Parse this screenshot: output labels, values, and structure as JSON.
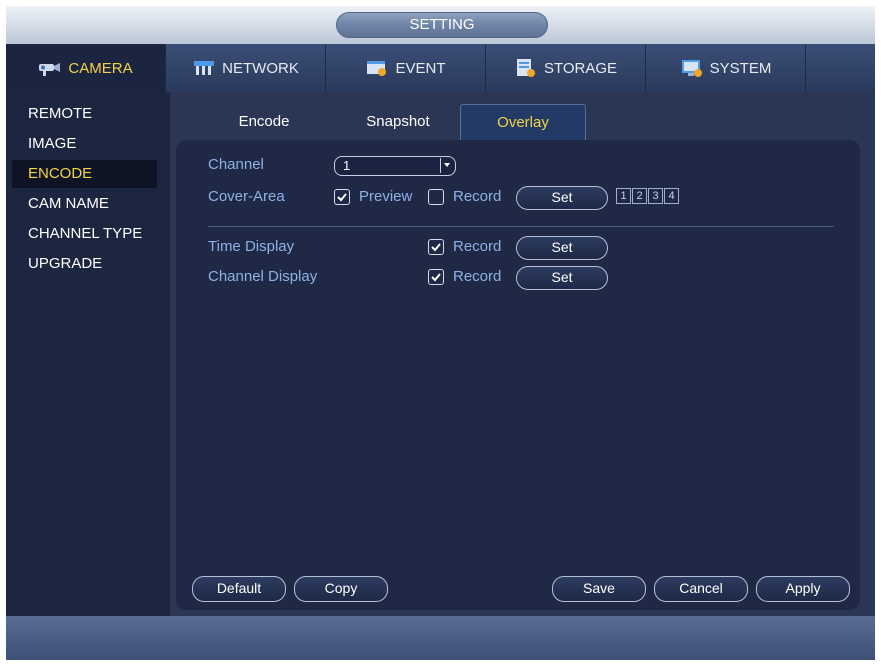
{
  "window": {
    "title": "SETTING"
  },
  "main_tabs": [
    {
      "label": "CAMERA",
      "icon": "camera-icon",
      "active": true
    },
    {
      "label": "NETWORK",
      "icon": "network-icon",
      "active": false
    },
    {
      "label": "EVENT",
      "icon": "event-icon",
      "active": false
    },
    {
      "label": "STORAGE",
      "icon": "storage-icon",
      "active": false
    },
    {
      "label": "SYSTEM",
      "icon": "system-icon",
      "active": false
    }
  ],
  "sidebar": {
    "items": [
      {
        "label": "REMOTE",
        "active": false
      },
      {
        "label": "IMAGE",
        "active": false
      },
      {
        "label": "ENCODE",
        "active": true
      },
      {
        "label": "CAM NAME",
        "active": false
      },
      {
        "label": "CHANNEL TYPE",
        "active": false
      },
      {
        "label": "UPGRADE",
        "active": false
      }
    ]
  },
  "sub_tabs": [
    {
      "label": "Encode",
      "active": false
    },
    {
      "label": "Snapshot",
      "active": false
    },
    {
      "label": "Overlay",
      "active": true
    }
  ],
  "overlay": {
    "channel": {
      "label": "Channel",
      "value": "1"
    },
    "cover_area": {
      "label": "Cover-Area",
      "preview_label": "Preview",
      "preview_checked": true,
      "record_label": "Record",
      "record_checked": false,
      "set_label": "Set",
      "regions": [
        "1",
        "2",
        "3",
        "4"
      ]
    },
    "time_display": {
      "label": "Time Display",
      "record_label": "Record",
      "record_checked": true,
      "set_label": "Set"
    },
    "channel_display": {
      "label": "Channel Display",
      "record_label": "Record",
      "record_checked": true,
      "set_label": "Set"
    }
  },
  "buttons": {
    "default": "Default",
    "copy": "Copy",
    "save": "Save",
    "cancel": "Cancel",
    "apply": "Apply"
  },
  "colors": {
    "accent": "#f2d443",
    "label": "#8fb0e6",
    "panel": "#1f2946"
  }
}
